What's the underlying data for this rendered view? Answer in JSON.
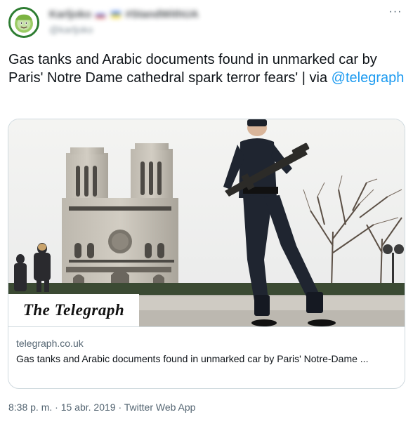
{
  "author": {
    "display_name": "Karljoko",
    "display_name_suffix": "#StandWithUA",
    "handle": "@karljoko",
    "avatar_icon": "cabbage-mascot-avatar"
  },
  "more_icon": "more-dots-icon",
  "tweet": {
    "text_main": "Gas tanks and Arabic documents found in unmarked car by Paris' Notre Dame cathedral spark terror fears' | via ",
    "mention": "@telegraph"
  },
  "card": {
    "brand": "The Telegraph",
    "domain": "telegraph.co.uk",
    "title": "Gas tanks and Arabic documents found in unmarked car by Paris' Notre-Dame ..."
  },
  "meta": {
    "time": "8:38 p. m.",
    "separator1": " · ",
    "date": "15 abr. 2019",
    "separator2": " · ",
    "source": "Twitter Web App"
  },
  "colors": {
    "link": "#1d9bf0",
    "secondary_text": "#536471",
    "border": "#cfd9de"
  }
}
